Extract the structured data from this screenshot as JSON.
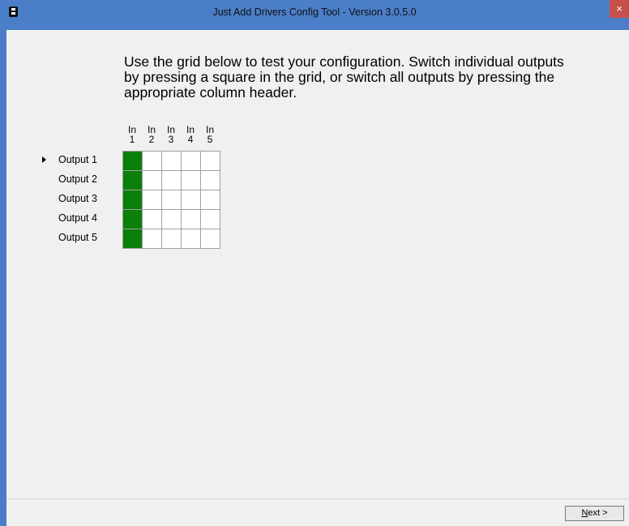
{
  "window": {
    "title": "Just Add Drivers Config Tool - Version 3.0.5.0",
    "close_label": "×"
  },
  "instructions": "Use the grid below to test your configuration. Switch individual outputs by pressing a square in the grid, or switch all outputs by pressing the appropriate column header.",
  "grid": {
    "columns": [
      {
        "line1": "In",
        "line2": "1"
      },
      {
        "line1": "In",
        "line2": "2"
      },
      {
        "line1": "In",
        "line2": "3"
      },
      {
        "line1": "In",
        "line2": "4"
      },
      {
        "line1": "In",
        "line2": "5"
      }
    ],
    "rows": [
      {
        "label": "Output 1",
        "current": true,
        "active_input": 1
      },
      {
        "label": "Output 2",
        "current": false,
        "active_input": 1
      },
      {
        "label": "Output 3",
        "current": false,
        "active_input": 1
      },
      {
        "label": "Output 4",
        "current": false,
        "active_input": 1
      },
      {
        "label": "Output 5",
        "current": false,
        "active_input": 1
      }
    ],
    "on_color": "#0a7f0a",
    "off_color": "#ffffff"
  },
  "footer": {
    "next_accel": "N",
    "next_rest": "ext >"
  },
  "colors": {
    "titlebar": "#4a7ec8",
    "close_button": "#c7504b",
    "client_background": "#f0f0f0"
  }
}
